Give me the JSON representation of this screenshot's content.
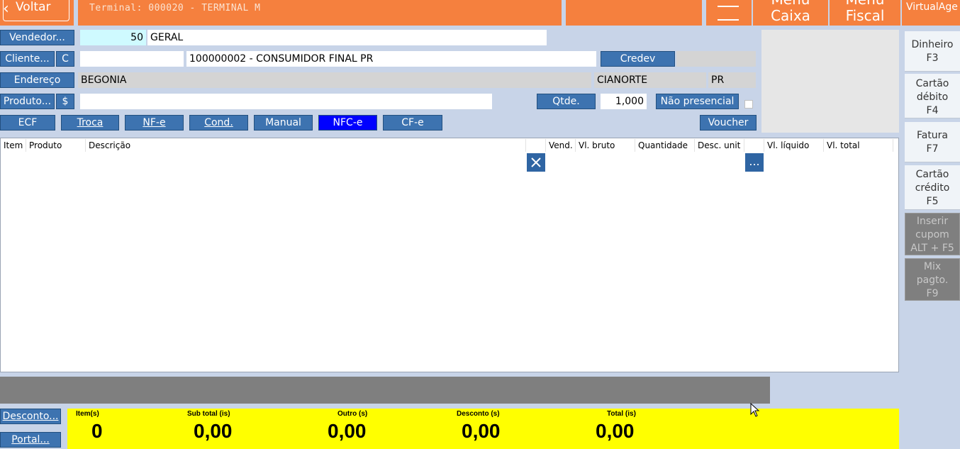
{
  "top": {
    "back_label": "Voltar",
    "terminal_label": "Terminal: 000020 - TERMINAL M",
    "menu_caixa": [
      "Menu",
      "Caixa"
    ],
    "menu_fiscal": [
      "Menu",
      "Fiscal"
    ],
    "brand": "VirtualAge"
  },
  "form": {
    "vendedor_btn": "Vendedor...",
    "vendedor_code": "50",
    "vendedor_name": "GERAL",
    "cliente_btn": "Cliente...",
    "cliente_c_btn": "C",
    "cliente_code": "",
    "cliente_name": "100000002 - CONSUMIDOR FINAL PR",
    "credev_btn": "Credev",
    "credev_value": "",
    "endereco_btn": "Endereço",
    "endereco_value": "BEGONIA",
    "city": "CIANORTE",
    "state": "PR",
    "produto_btn": "Produto...",
    "produto_dollar_btn": "$",
    "produto_value": "",
    "qtde_btn": "Qtde.",
    "qtde_value": "1,000",
    "nao_presencial_btn": "Não presencial"
  },
  "modes": {
    "ecf": "ECF",
    "troca": "Troca",
    "nfe": "NF-e",
    "cond": "Cond.",
    "manual": "Manual",
    "nfce": "NFC-e",
    "cfe": "CF-e",
    "voucher": "Voucher"
  },
  "table": {
    "headers": [
      "Item",
      "Produto",
      "Descrição",
      "Vend.",
      "Vl. bruto",
      "Quantidade",
      "Desc. unit",
      "Vl. líquido",
      "Vl. total"
    ],
    "delete_icon": "close-icon",
    "more_label": "..."
  },
  "payments": [
    {
      "label": [
        "Dinheiro",
        "F3"
      ]
    },
    {
      "label": [
        "Cartão",
        "débito",
        "F4"
      ]
    },
    {
      "label": [
        "Fatura",
        "F7"
      ]
    },
    {
      "label": [
        "Cartão",
        "crédito",
        "F5"
      ]
    },
    {
      "label": [
        "Inserir",
        "cupom",
        "ALT + F5"
      ]
    },
    {
      "label": [
        "Mix",
        "pagto.",
        "F9"
      ]
    }
  ],
  "footer": {
    "desconto_btn": "Desconto...",
    "portal_btn": "Portal...",
    "items_label": "Item(s)",
    "items_value": "0",
    "subtotal_label": "Sub total (is)",
    "subtotal_value": "0,00",
    "outro_label": "Outro (s)",
    "outro_value": "0,00",
    "desconto_label": "Desconto (s)",
    "desconto_value": "0,00",
    "total_label": "Total (is)",
    "total_value": "0,00"
  },
  "colors": {
    "top_bar": "#f5803e",
    "button_blue": "#3d73b0",
    "active_mode": "#0000ff",
    "totals_bg": "#ffff00"
  }
}
